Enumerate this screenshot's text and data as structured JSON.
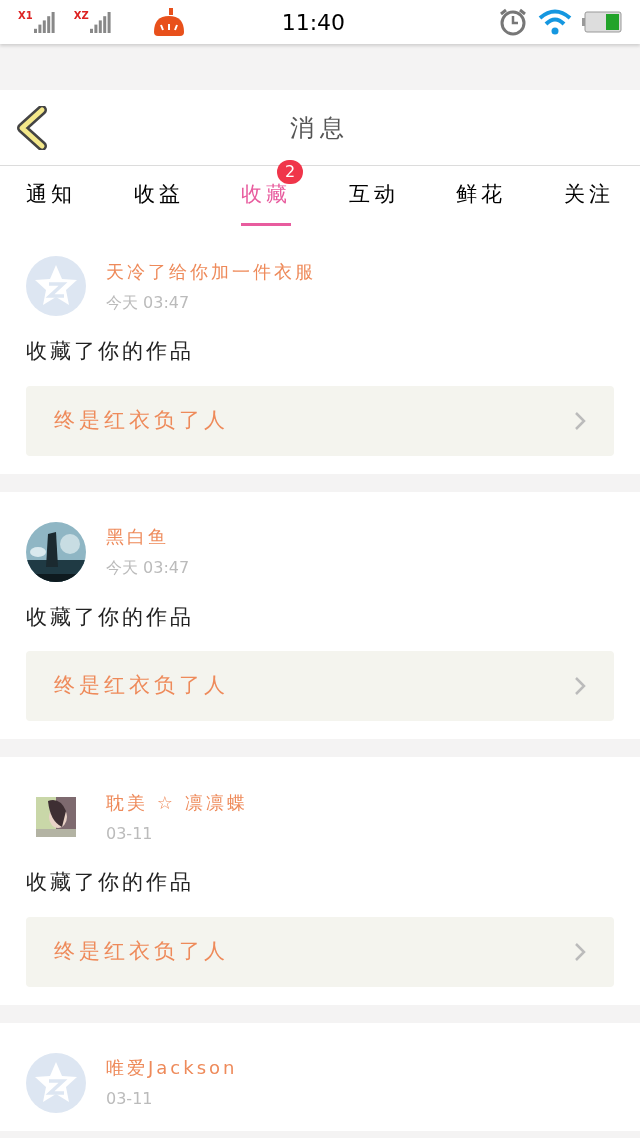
{
  "status_bar": {
    "sims": [
      "X1",
      "XZ"
    ],
    "time": "11:40"
  },
  "header": {
    "title": "消息"
  },
  "tabs": [
    {
      "label": "通知",
      "selected": false
    },
    {
      "label": "收益",
      "selected": false
    },
    {
      "label": "收藏",
      "selected": true,
      "badge": "2"
    },
    {
      "label": "互动",
      "selected": false
    },
    {
      "label": "鲜花",
      "selected": false
    },
    {
      "label": "关注",
      "selected": false
    }
  ],
  "messages": [
    {
      "kind": "default",
      "name": "天冷了给你加一件衣服",
      "time": "今天 03:47",
      "text": "收藏了你的作品",
      "work": "终是红衣负了人"
    },
    {
      "kind": "photo-round",
      "name": "黑白鱼",
      "time": "今天 03:47",
      "text": "收藏了你的作品",
      "work": "终是红衣负了人"
    },
    {
      "kind": "photo-square",
      "name": "耽美 ☆ 凛凛蝶",
      "time": "03-11",
      "text": "收藏了你的作品",
      "work": "终是红衣负了人"
    },
    {
      "kind": "default",
      "name": "唯爱Jackson",
      "time": "03-11"
    }
  ]
}
